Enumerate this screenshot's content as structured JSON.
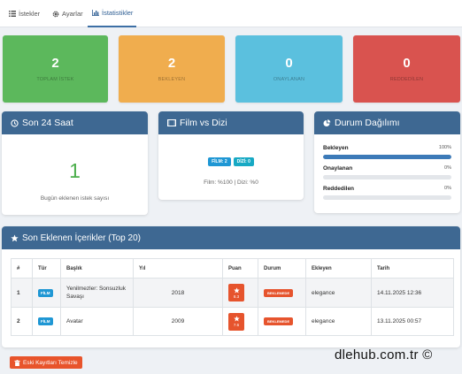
{
  "tabs": [
    {
      "label": "İstekler",
      "icon": "list-icon"
    },
    {
      "label": "Ayarlar",
      "icon": "gear-icon"
    },
    {
      "label": "İstatistikler",
      "icon": "bar-chart-icon",
      "active": true
    }
  ],
  "stats": [
    {
      "value": "2",
      "label": "TOPLAM İSTEK",
      "color": "#5cb85c"
    },
    {
      "value": "2",
      "label": "BEKLEYEN",
      "color": "#f0ad4e"
    },
    {
      "value": "0",
      "label": "ONAYLANAN",
      "color": "#5bc0de"
    },
    {
      "value": "0",
      "label": "REDDEDİLEN",
      "color": "#d9534f"
    }
  ],
  "last24": {
    "title": "Son 24 Saat",
    "value": "1",
    "subtitle": "Bugün eklenen istek sayısı"
  },
  "film_vs_dizi": {
    "title": "Film vs Dizi",
    "film_badge": "FİLM: 2",
    "dizi_badge": "DİZİ: 0",
    "ratio_text": "Film: %100 | Dizi: %0"
  },
  "status_dist": {
    "title": "Durum Dağılımı",
    "rows": [
      {
        "label": "Bekleyen",
        "percent_text": "100%",
        "fraction": 1.0
      },
      {
        "label": "Onaylanan",
        "percent_text": "0%",
        "fraction": 0.0
      },
      {
        "label": "Reddedilen",
        "percent_text": "0%",
        "fraction": 0.0
      }
    ]
  },
  "recent": {
    "title": "Son Eklenen İçerikler (Top 20)",
    "columns": [
      "#",
      "Tür",
      "Başlık",
      "Yıl",
      "Puan",
      "Durum",
      "Ekleyen",
      "Tarih"
    ],
    "rows": [
      {
        "no": "1",
        "type": "FİLM",
        "title": "Yenilmezler: Sonsuzluk Savaşı",
        "year": "2018",
        "score": "8.3",
        "status": "BEKLEMEDE",
        "user": "elegance",
        "date": "14.11.2025 12:36"
      },
      {
        "no": "2",
        "type": "FİLM",
        "title": "Avatar",
        "year": "2009",
        "score": "7.6",
        "status": "BEKLEMEDE",
        "user": "elegance",
        "date": "13.11.2025 00:57"
      }
    ]
  },
  "clear_button": "Eski Kayıtları Temizle",
  "watermark": "dlehub.com.tr ©"
}
